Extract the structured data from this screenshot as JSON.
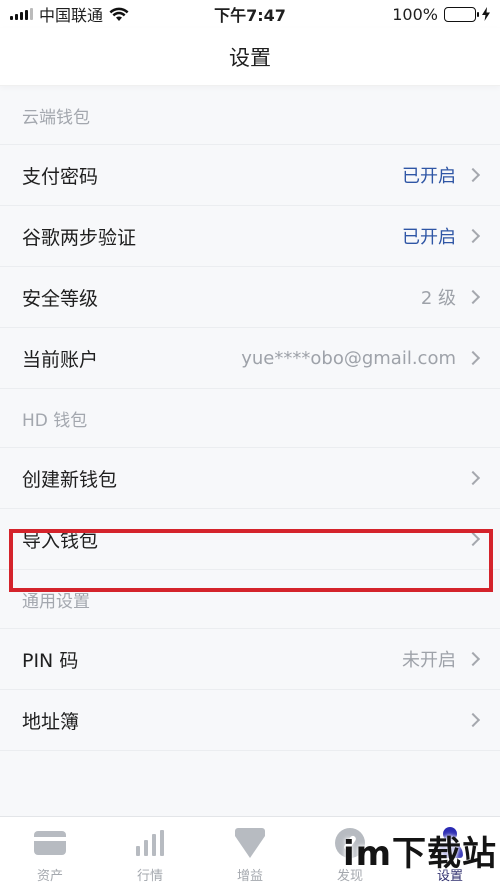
{
  "status_bar": {
    "carrier": "中国联通",
    "time": "下午7:47",
    "battery": "100%",
    "icons": [
      "signal-icon",
      "wifi-icon",
      "battery-icon",
      "charging-icon"
    ]
  },
  "nav": {
    "title": "设置"
  },
  "sections": [
    {
      "header": "云端钱包",
      "rows": [
        {
          "label": "支付密码",
          "value": "已开启",
          "value_on": true
        },
        {
          "label": "谷歌两步验证",
          "value": "已开启",
          "value_on": true
        },
        {
          "label": "安全等级",
          "value": "2 级",
          "value_on": false
        },
        {
          "label": "当前账户",
          "value": "yue****obo@gmail.com",
          "value_on": false
        }
      ]
    },
    {
      "header": "HD 钱包",
      "rows": [
        {
          "label": "创建新钱包",
          "value": ""
        },
        {
          "label": "导入钱包",
          "value": "",
          "highlighted": true
        }
      ]
    },
    {
      "header": "通用设置",
      "rows": [
        {
          "label": "PIN 码",
          "value": "未开启",
          "value_on": false
        },
        {
          "label": "地址簿",
          "value": ""
        }
      ]
    }
  ],
  "tabs": [
    {
      "label": "资产",
      "icon": "wallet-card-icon"
    },
    {
      "label": "行情",
      "icon": "bar-chart-icon"
    },
    {
      "label": "增益",
      "icon": "diamond-icon"
    },
    {
      "label": "发现",
      "icon": "compass-icon"
    },
    {
      "label": "设置",
      "icon": "person-icon",
      "active": true
    }
  ],
  "watermark": "im下载站",
  "colors": {
    "enabled_value": "#2f56a5",
    "highlight_border": "#d4232b",
    "battery_fill": "#3dcc4a",
    "active_tab_icon": "#2b2bb3"
  }
}
